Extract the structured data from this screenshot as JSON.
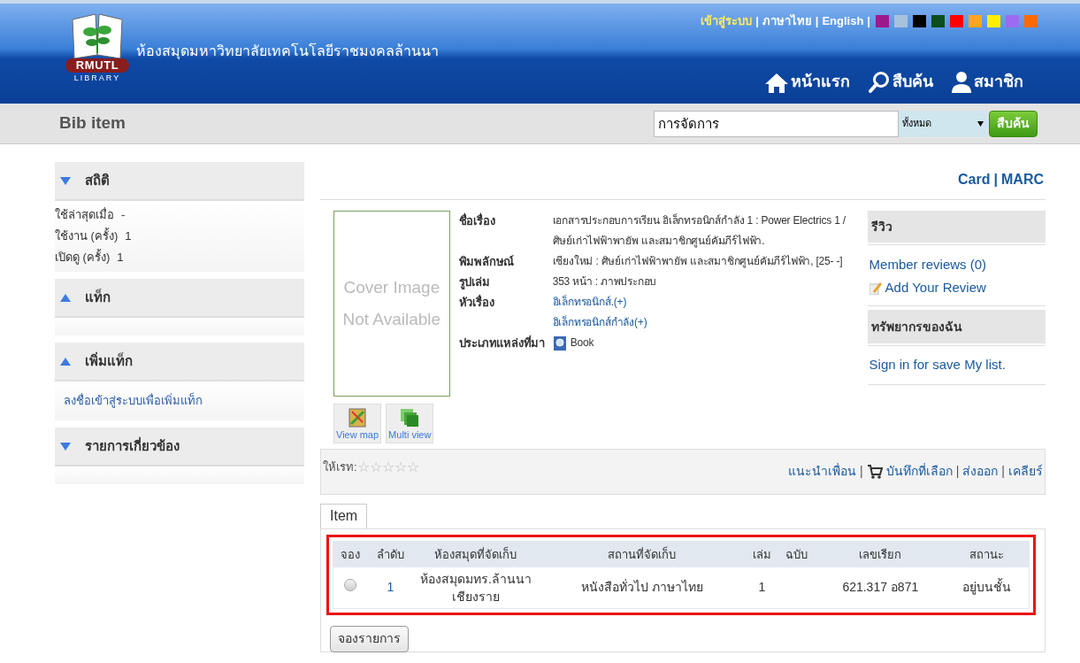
{
  "header": {
    "logo_text": "RMUTL",
    "logo_sub": "LIBRARY",
    "site_title": "ห้องสมุดมหาวิทยาลัยเทคโนโลยีราชมงคลล้านนา",
    "top_links": [
      "เข้าสู่ระบบ",
      "ภาษาไทย",
      "English"
    ],
    "themes": [
      {
        "color": "#9c1a8c"
      },
      {
        "color": "#a9c1dc"
      },
      {
        "color": "#000000"
      },
      {
        "color": "#0b4d1e"
      },
      {
        "color": "#ff0000"
      },
      {
        "color": "#ffa521"
      },
      {
        "color": "#ffee00"
      },
      {
        "color": "#9b6cf0"
      },
      {
        "color": "#ff6a00"
      }
    ],
    "nav": [
      {
        "kind": "home",
        "label": "หน้าแรก"
      },
      {
        "kind": "search",
        "label": "สืบค้น"
      },
      {
        "kind": "member",
        "label": "สมาชิก"
      }
    ]
  },
  "toolbar": {
    "title": "Bib item",
    "search_value": "การจัดการ",
    "scope": "ทั้งหมด",
    "search_button": "สืบค้น"
  },
  "sidebar": [
    {
      "title": "สถิติ",
      "expanded": true,
      "rows": [
        [
          "ใช้ล่าสุดเมื่อ",
          "-"
        ],
        [
          "ใช้งาน (ครั้ง)",
          "1"
        ],
        [
          "เปิดดู (ครั้ง)",
          "1"
        ]
      ]
    },
    {
      "title": "แท็ก",
      "expanded": false
    },
    {
      "title": "เพิ่มแท็ก",
      "expanded": false,
      "link": "ลงชื่อเข้าสู่ระบบเพื่อเพิ่มแท็ก"
    },
    {
      "title": "รายการเกี่ยวข้อง",
      "expanded": true
    }
  ],
  "view_links": [
    "Card",
    "MARC"
  ],
  "cover": {
    "line1": "Cover Image",
    "line2": "Not Available"
  },
  "cover_buttons": [
    {
      "kind": "map",
      "label": "View map"
    },
    {
      "kind": "multi",
      "label": "Multi view"
    }
  ],
  "fields": [
    {
      "label": "ชื่อเรื่อง",
      "values": [
        {
          "text": "เอกสารประกอบการเรียน อิเล็กทรอนิกส์กำลัง 1 : Power Electrics 1 / ศิษย์เก่าไฟฟ้าพายัพ และสมาชิกศูนย์คัมภีร์ไฟฟ้า.",
          "kind": "text"
        }
      ]
    },
    {
      "label": "พิมพลักษณ์",
      "values": [
        {
          "text": "เชียงใหม่ : ศิษย์เก่าไฟฟ้าพายัพ และสมาชิกศูนย์คัมภีร์ไฟฟ้า, [25- -]",
          "kind": "text"
        }
      ]
    },
    {
      "label": "รูปเล่ม",
      "values": [
        {
          "text": "353 หน้า : ภาพประกอบ",
          "kind": "text"
        }
      ]
    },
    {
      "label": "หัวเรื่อง",
      "values": [
        {
          "text": "อิเล็กทรอนิกส์.(+)",
          "kind": "link"
        },
        {
          "text": "อิเล็กทรอนิกส์กำลัง(+)",
          "kind": "link"
        }
      ]
    },
    {
      "label": "ประเภทแหล่งที่มา",
      "values": [
        {
          "text": "Book",
          "kind": "book"
        }
      ]
    }
  ],
  "review": {
    "title": "รีวิว",
    "member_reviews": "Member reviews (0)",
    "add_review": "Add Your Review",
    "my_title": "ทรัพยากรของฉัน",
    "sign_in": "Sign in for save My list."
  },
  "rating": {
    "label": "ให้เรท:",
    "stars": 0
  },
  "actions": [
    {
      "kind": "link",
      "label": "แนะนำเพื่อน"
    },
    {
      "kind": "cart",
      "label": "บันทึกที่เลือก"
    },
    {
      "kind": "link",
      "label": "ส่งออก"
    },
    {
      "kind": "link",
      "label": "เคลียร์"
    }
  ],
  "tabs": [
    {
      "label": "Item",
      "selected": true
    }
  ],
  "table": {
    "columns": [
      "จอง",
      "ลำดับ",
      "ห้องสมุดที่จัดเก็บ",
      "สถานที่จัดเก็บ",
      "เล่ม",
      "ฉบับ",
      "เลขเรียก",
      "สถานะ"
    ],
    "rows": [
      {
        "selected": false,
        "no": "1",
        "library": "ห้องสมุดมทร.ล้านนา เชียงราย",
        "location": "หนังสือทั่วไป ภาษาไทย",
        "volume": "1",
        "call_no": "621.317 อ871",
        "status": "อยู่บนชั้น"
      }
    ]
  },
  "reserve_button": "จองรายการ",
  "separator": "|"
}
